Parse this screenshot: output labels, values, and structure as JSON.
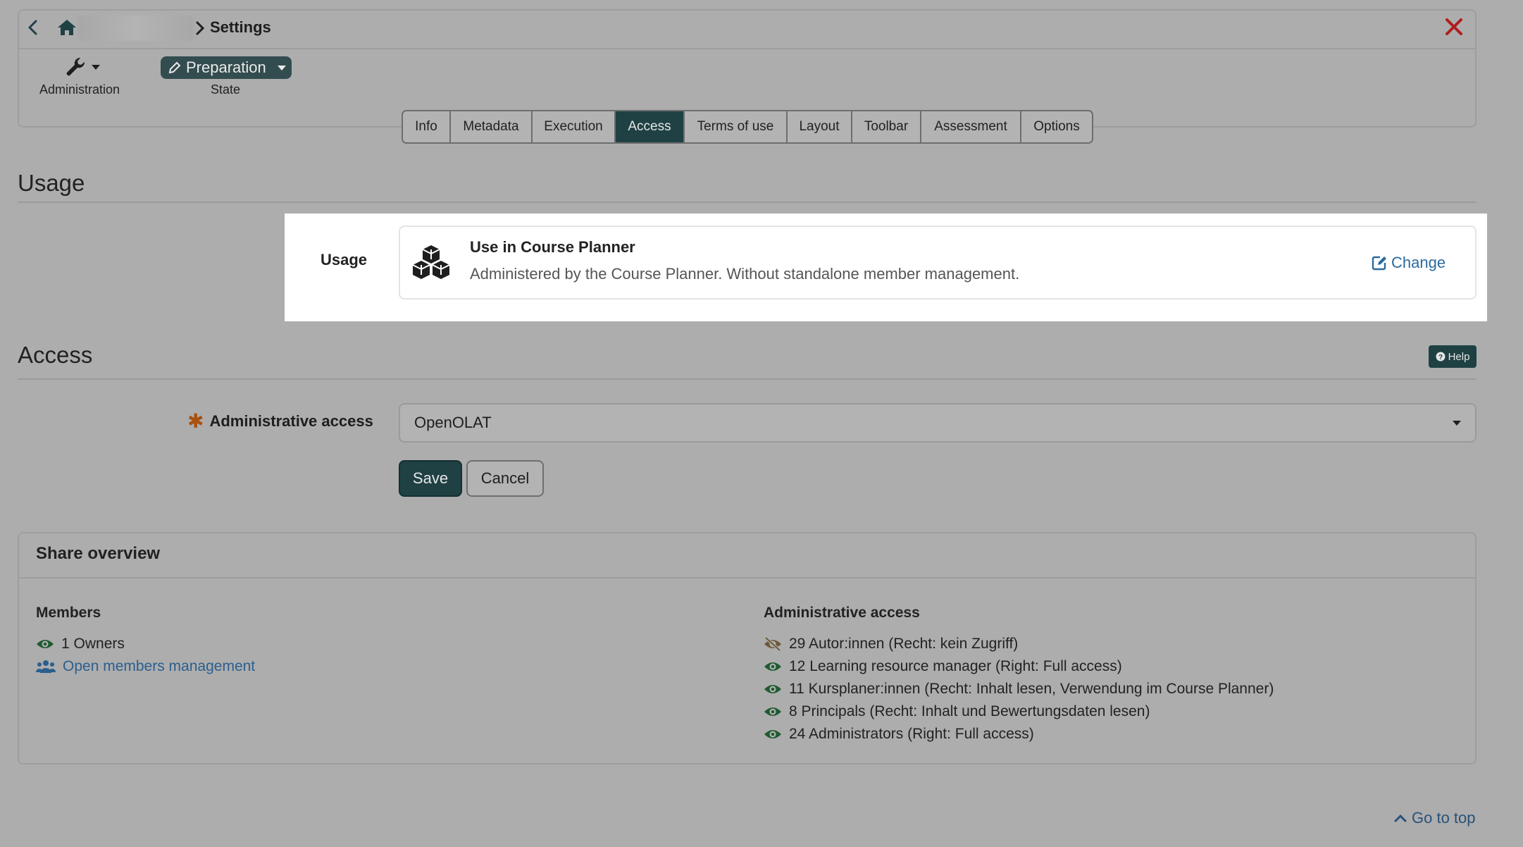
{
  "header": {
    "breadcrumb_current": "Settings",
    "back_icon": "chevron-left-icon",
    "home_icon": "home-icon",
    "close_icon": "close-icon"
  },
  "tools": {
    "administration_label": "Administration",
    "state_value": "Preparation",
    "state_label": "State"
  },
  "tabs": [
    {
      "label": "Info",
      "active": false
    },
    {
      "label": "Metadata",
      "active": false
    },
    {
      "label": "Execution",
      "active": false
    },
    {
      "label": "Access",
      "active": true
    },
    {
      "label": "Terms of use",
      "active": false
    },
    {
      "label": "Layout",
      "active": false
    },
    {
      "label": "Toolbar",
      "active": false
    },
    {
      "label": "Assessment",
      "active": false
    },
    {
      "label": "Options",
      "active": false
    }
  ],
  "usage": {
    "section_title": "Usage",
    "field_label": "Usage",
    "card_title": "Use in Course Planner",
    "card_description": "Administered by the Course Planner. Without standalone member management.",
    "change_label": "Change"
  },
  "access": {
    "section_title": "Access",
    "help_label": "Help",
    "admin_access_label": "Administrative access",
    "admin_access_value": "OpenOLAT",
    "save_label": "Save",
    "cancel_label": "Cancel"
  },
  "share_overview": {
    "title": "Share overview",
    "members_title": "Members",
    "members": [
      {
        "text": "1 Owners"
      }
    ],
    "open_members_label": "Open members management",
    "admin_access_title": "Administrative access",
    "admin_access_items": [
      {
        "text": "29 Autor:innen (Recht: kein Zugriff)",
        "visible": false
      },
      {
        "text": "12 Learning resource manager (Right: Full access)",
        "visible": true
      },
      {
        "text": "11 Kursplaner:innen (Recht: Inhalt lesen, Verwendung im Course Planner)",
        "visible": true
      },
      {
        "text": "8 Principals (Recht: Inhalt und Bewertungsdaten lesen)",
        "visible": true
      },
      {
        "text": "24 Administrators (Right: Full access)",
        "visible": true
      }
    ]
  },
  "footer": {
    "go_top_label": "Go to top"
  },
  "colors": {
    "accent_dark": "#1f4144",
    "close_red": "#b01c1c",
    "link_blue": "#2a6aa0",
    "required_orange": "#a8500f"
  }
}
